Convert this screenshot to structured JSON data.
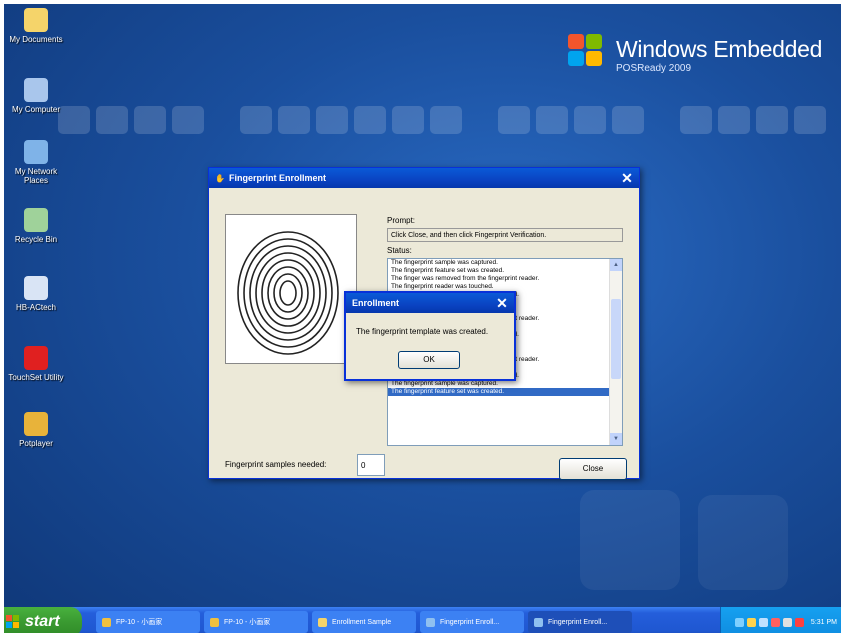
{
  "desktop": {
    "icons": [
      {
        "label": "My Documents",
        "color": "#f5d46a"
      },
      {
        "label": "My Computer",
        "color": "#a9c6ec"
      },
      {
        "label": "My Network Places",
        "color": "#7fb3e8"
      },
      {
        "label": "Recycle Bin",
        "color": "#9fd29a"
      },
      {
        "label": "HB-ACtech",
        "color": "#d9e4f5"
      },
      {
        "label": "TouchSet Utility",
        "color": "#e02020"
      },
      {
        "label": "Potplayer",
        "color": "#e8b33a"
      }
    ],
    "brand_name": "Windows Embedded",
    "brand_sub": "POSReady 2009"
  },
  "enrollment_window": {
    "title": "Fingerprint Enrollment",
    "prompt_label": "Prompt:",
    "prompt_text": "Click Close, and then click Fingerprint Verification.",
    "status_label": "Status:",
    "status_lines": [
      "The fingerprint sample was captured.",
      "The fingerprint feature set was created.",
      "The finger was removed from the fingerprint reader.",
      "The fingerprint reader was touched.",
      "The quality of the fingerprint sample is good.",
      "The fingerprint sample was captured.",
      "The fingerprint feature set was created.",
      "The finger was removed from the fingerprint reader.",
      "The fingerprint reader was touched.",
      "The quality of the fingerprint sample is good.",
      "The fingerprint sample was captured.",
      "The fingerprint feature set was created.",
      "The finger was removed from the fingerprint reader.",
      "The fingerprint reader was touched.",
      "The quality of the fingerprint sample is good.",
      "The fingerprint sample was captured.",
      "The fingerprint feature set was created."
    ],
    "samples_label": "Fingerprint samples needed:",
    "samples_value": "0",
    "close_button": "Close"
  },
  "dialog": {
    "title": "Enrollment",
    "message": "The fingerprint template was created.",
    "ok_button": "OK"
  },
  "taskbar": {
    "start_label": "start",
    "tasks": [
      {
        "label": "FP-10 - 小画家",
        "color": "#f0c040"
      },
      {
        "label": "FP-10 - 小画家",
        "color": "#f0c040"
      },
      {
        "label": "Enrollment Sample",
        "color": "#f5d46a"
      },
      {
        "label": "Fingerprint Enroll...",
        "color": "#8fc0f0"
      },
      {
        "label": "Fingerprint Enroll...",
        "color": "#8fc0f0"
      }
    ],
    "clock": "5:31 PM"
  }
}
